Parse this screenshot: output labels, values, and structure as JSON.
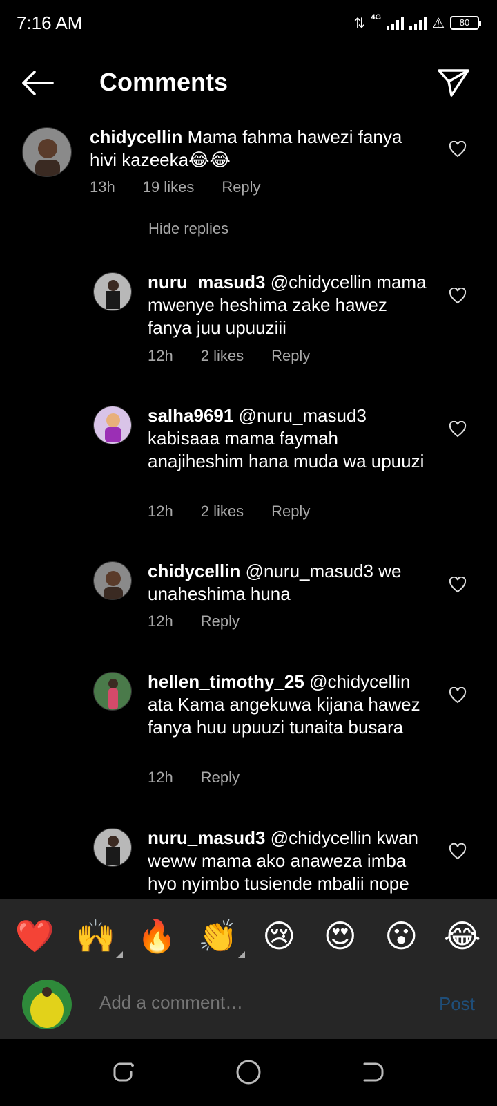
{
  "status": {
    "time": "7:16 AM",
    "network": "4G",
    "battery": "80"
  },
  "header": {
    "title": "Comments"
  },
  "comments": [
    {
      "username": "chidycellin",
      "text": " Mama fahma hawezi fanya hivi kazeeka😂😂",
      "time": "13h",
      "likes": "19 likes",
      "reply": "Reply"
    }
  ],
  "hide_replies": "Hide replies",
  "replies": [
    {
      "username": "nuru_masud3",
      "text": " @chidycellin mama mwenye heshima zake hawez fanya juu upuuziii",
      "time": "12h",
      "likes": "2 likes",
      "reply": "Reply"
    },
    {
      "username": "salha9691",
      "text": " @nuru_masud3 kabisaaa mama faymah anajiheshim hana muda wa upuuzi",
      "time": "12h",
      "likes": "2 likes",
      "reply": "Reply"
    },
    {
      "username": "chidycellin",
      "text": " @nuru_masud3  we unaheshima huna",
      "time": "12h",
      "likes": "",
      "reply": "Reply"
    },
    {
      "username": "hellen_timothy_25",
      "text": " @chidycellin ata Kama angekuwa kijana hawez fanya huu upuuzi tunaita busara",
      "time": "12h",
      "likes": "",
      "reply": "Reply"
    },
    {
      "username": "nuru_masud3",
      "text": " @chidycellin kwan weww mama ako anaweza imba hyo nyimbo tusiende mbalii nope",
      "time": "",
      "likes": "",
      "reply": ""
    }
  ],
  "emojis": [
    "❤️",
    "🙌",
    "🔥",
    "👏",
    "😢",
    "😍",
    "😮",
    "😂"
  ],
  "input": {
    "placeholder": "Add a comment…",
    "post_label": "Post"
  },
  "icons": [
    "back-arrow-icon",
    "send-icon",
    "heart-icon",
    "recent-apps-icon",
    "home-icon",
    "back-nav-icon"
  ]
}
